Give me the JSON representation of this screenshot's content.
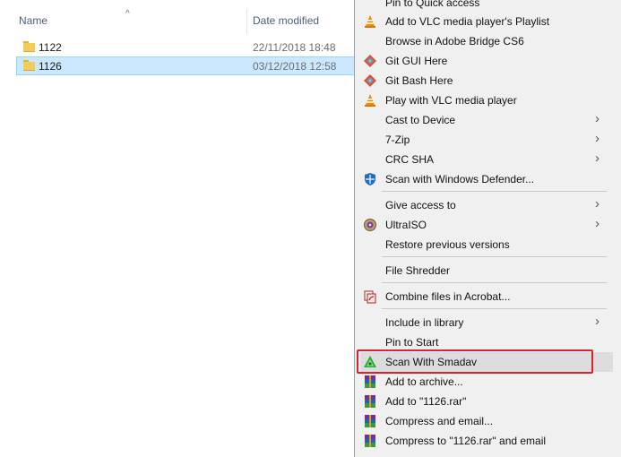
{
  "explorer": {
    "columns": {
      "name": "Name",
      "date_modified": "Date modified"
    },
    "files": [
      {
        "name": "1122",
        "date": "22/11/2018 18:48",
        "selected": false
      },
      {
        "name": "1126",
        "date": "03/12/2018 12:58",
        "selected": true
      }
    ]
  },
  "context_menu": {
    "items": [
      {
        "label": "Pin to Quick access",
        "icon": "pin-icon"
      },
      {
        "label": "Add to VLC media player's Playlist",
        "icon": "vlc-cone-icon"
      },
      {
        "label": "Browse in Adobe Bridge CS6",
        "icon": ""
      },
      {
        "label": "Git GUI Here",
        "icon": "git-icon"
      },
      {
        "label": "Git Bash Here",
        "icon": "git-icon"
      },
      {
        "label": "Play with VLC media player",
        "icon": "vlc-cone-icon"
      },
      {
        "label": "Cast to Device",
        "icon": "",
        "submenu": true
      },
      {
        "label": "7-Zip",
        "icon": "",
        "submenu": true
      },
      {
        "label": "CRC SHA",
        "icon": "",
        "submenu": true
      },
      {
        "label": "Scan with Windows Defender...",
        "icon": "defender-shield-icon"
      },
      {
        "label": "Give access to",
        "icon": "",
        "submenu": true
      },
      {
        "label": "UltraISO",
        "icon": "ultraiso-disc-icon",
        "submenu": true
      },
      {
        "label": "Restore previous versions",
        "icon": ""
      },
      {
        "label": "File Shredder",
        "icon": ""
      },
      {
        "label": "Combine files in Acrobat...",
        "icon": "acrobat-icon"
      },
      {
        "label": "Include in library",
        "icon": "",
        "submenu": true
      },
      {
        "label": "Pin to Start",
        "icon": ""
      },
      {
        "label": "Scan With Smadav",
        "icon": "smadav-icon",
        "highlighted": true
      },
      {
        "label": "Add to archive...",
        "icon": "winrar-icon"
      },
      {
        "label": "Add to \"1126.rar\"",
        "icon": "winrar-icon"
      },
      {
        "label": "Compress and email...",
        "icon": "winrar-icon"
      },
      {
        "label": "Compress to \"1126.rar\" and email",
        "icon": "winrar-icon"
      }
    ]
  },
  "colors": {
    "selection_bg": "#cce8ff",
    "menu_bg": "#f0f0f0",
    "highlight_border": "#e0202a",
    "vlc_orange": "#f08a00",
    "smadav_green": "#2ea836"
  }
}
